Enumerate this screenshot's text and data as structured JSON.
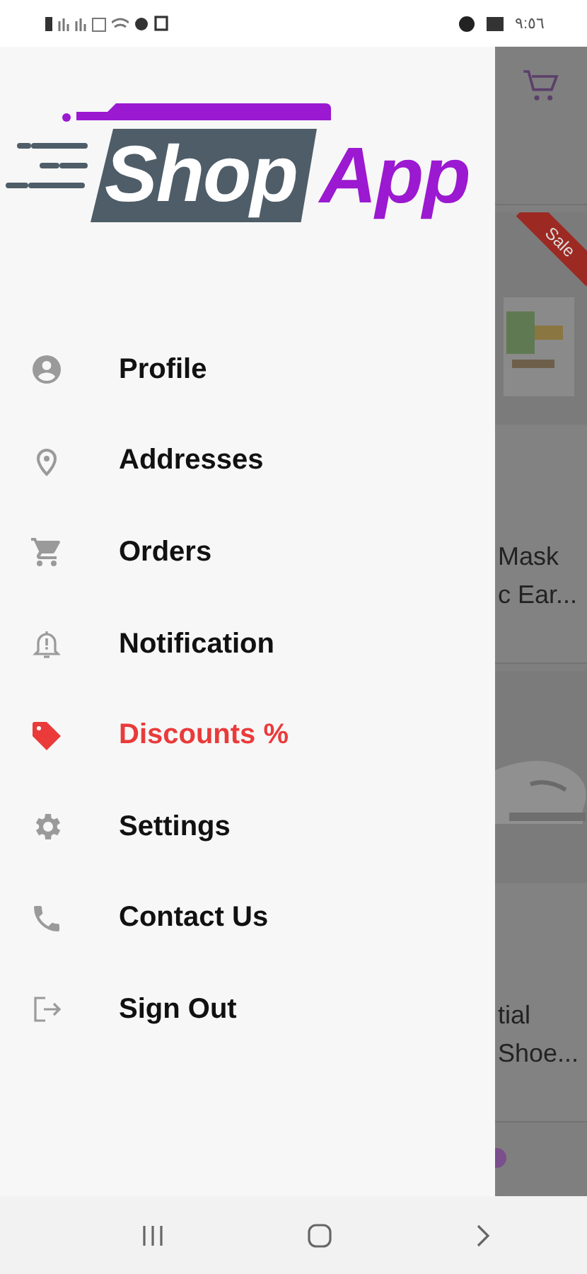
{
  "status_bar": {
    "time": "٩:٥٦"
  },
  "drawer": {
    "logo": {
      "word_1": "Shop",
      "word_2": "App"
    },
    "items": [
      {
        "label": "Profile",
        "selected": false
      },
      {
        "label": "Addresses",
        "selected": false
      },
      {
        "label": "Orders",
        "selected": false
      },
      {
        "label": "Notification",
        "selected": false
      },
      {
        "label": "Discounts %",
        "selected": true
      },
      {
        "label": "Settings",
        "selected": false
      },
      {
        "label": "Contact Us",
        "selected": false
      },
      {
        "label": "Sign Out",
        "selected": false
      }
    ]
  },
  "background_page": {
    "products": [
      {
        "ribbon": "Sale",
        "line_1": "Mask",
        "line_2": "c Ear..."
      },
      {
        "line_1": "tial",
        "line_2": "Shoe..."
      }
    ]
  }
}
